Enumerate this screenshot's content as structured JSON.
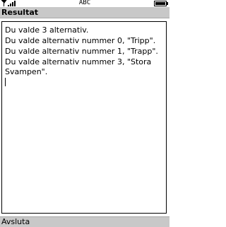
{
  "status_bar": {
    "signal_icon": "signal-strength-icon",
    "input_mode": "ABC",
    "battery_icon": "battery-icon"
  },
  "title": "Resultat",
  "text_area": {
    "lines": [
      "Du valde 3 alternativ.",
      "Du valde alternativ nummer 0, \"Tripp\".",
      "Du valde alternativ nummer 1, \"Trapp\".",
      "Du valde alternativ nummer 3, \"Stora",
      "Svampen\"."
    ]
  },
  "softkeys": {
    "left": "Avsluta"
  }
}
